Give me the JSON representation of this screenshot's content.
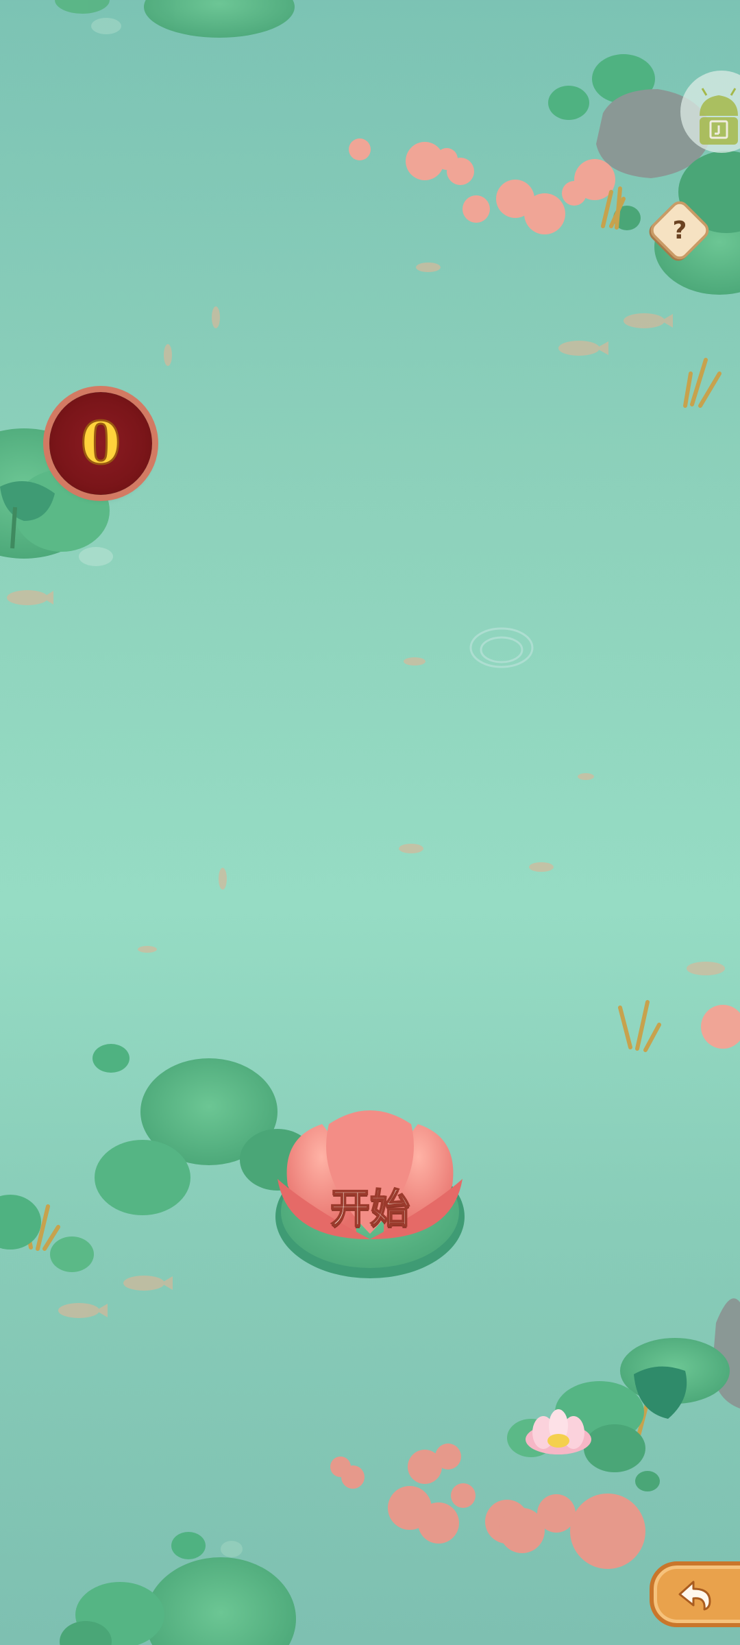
{
  "game": {
    "score": "0",
    "start_label": "开始",
    "help_icon_char": "?"
  },
  "icons": {
    "help": "question-mark-icon",
    "back": "back-arrow-icon",
    "android": "android-logo-icon"
  },
  "colors": {
    "water_top": "#7cc3b4",
    "water_mid": "#96dcc4",
    "lily_pad": "#5fb98a",
    "lotus_pink": "#ef8a86",
    "koi": "#d9b79a",
    "score_badge": "#7a1519",
    "score_digit": "#ffd33c",
    "back_button": "#e9a24c"
  }
}
